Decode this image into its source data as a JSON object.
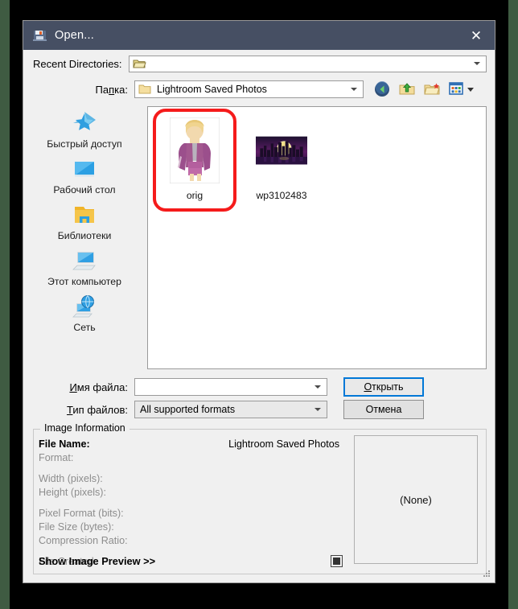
{
  "window": {
    "title": "Open...",
    "title_icon": "save-disk-icon",
    "close_label": "✕"
  },
  "recent": {
    "label": "Recent Directories:",
    "value": "",
    "icon": "open-folder-icon"
  },
  "folder": {
    "label_pre": "Па",
    "label_accel": "п",
    "label_post": "ка:",
    "label_full": "Папка:",
    "value": "Lightroom Saved Photos",
    "icon": "folder-icon"
  },
  "toolbar": {
    "buttons": [
      {
        "name": "back-button",
        "icon": "back-arrow-icon"
      },
      {
        "name": "up-folder-button",
        "icon": "up-folder-icon"
      },
      {
        "name": "new-folder-button",
        "icon": "new-folder-icon"
      },
      {
        "name": "views-button",
        "icon": "views-grid-icon"
      }
    ]
  },
  "places": {
    "items": [
      {
        "label": "Быстрый доступ",
        "icon": "quick-access-star-icon"
      },
      {
        "label": "Рабочий стол",
        "icon": "desktop-icon"
      },
      {
        "label": "Библиотеки",
        "icon": "libraries-folder-icon"
      },
      {
        "label": "Этот компьютер",
        "icon": "this-pc-icon"
      },
      {
        "label": "Сеть",
        "icon": "network-globe-icon"
      }
    ]
  },
  "filelist": {
    "items": [
      {
        "label": "orig",
        "type": "portrait-thumbnail",
        "highlighted": true
      },
      {
        "label": "wp3102483",
        "type": "cityscape-thumbnail",
        "highlighted": false
      }
    ]
  },
  "form": {
    "filename_label_pre": "И",
    "filename_label_post": "мя файла:",
    "filename_label_full": "Имя файла:",
    "filename_value": "",
    "filetype_label_pre": "Т",
    "filetype_label_post": "ип файлов:",
    "filetype_label_full": "Тип файлов:",
    "filetype_value": "All supported formats",
    "open_label_pre": "О",
    "open_label_post": "ткрыть",
    "open_label_full": "Открыть",
    "cancel_label": "Отмена"
  },
  "info": {
    "legend": "Image Information",
    "rows": [
      {
        "key": "File Name:",
        "value": "Lightroom Saved Photos",
        "active": true
      },
      {
        "key": "Format:",
        "value": "",
        "active": false
      },
      {
        "key": "Width (pixels):",
        "value": "",
        "active": false
      },
      {
        "key": "Height (pixels):",
        "value": "",
        "active": false
      },
      {
        "key": "Pixel Format (bits):",
        "value": "",
        "active": false
      },
      {
        "key": "File Size (bytes):",
        "value": "",
        "active": false
      },
      {
        "key": "Compression Ratio:",
        "value": "",
        "active": false
      },
      {
        "key": "File Created:",
        "value": "",
        "active": false
      }
    ],
    "preview_toggle_label": "Show Image Preview  >>",
    "preview_placeholder": "(None)"
  },
  "colors": {
    "titlebar": "#464f63",
    "accent": "#0078d7",
    "annotation": "#f51b1b",
    "window_bg": "#f0f0f0",
    "desktop_strip": "#3f5b42"
  }
}
